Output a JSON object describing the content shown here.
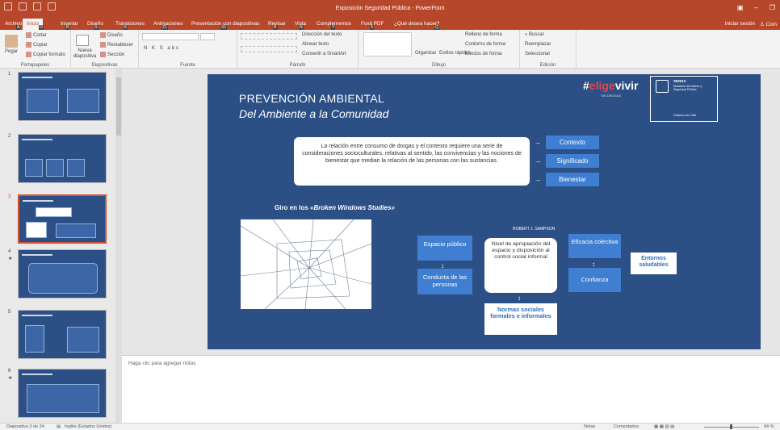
{
  "app": {
    "title": "Exposición Seguridad Pública - PowerPoint",
    "signin": "Iniciar sesión",
    "share": "Com"
  },
  "tabs": [
    "Archivo",
    "Inicio",
    "Insertar",
    "Diseño",
    "Transiciones",
    "Animaciones",
    "Presentación con diapositivas",
    "Revisar",
    "Vista",
    "Complementos",
    "Foxit PDF",
    "¿Qué desea hacer?"
  ],
  "keytips": [
    "A",
    "O",
    "B",
    "G",
    "K",
    "Z1",
    "S1",
    "R",
    "N",
    "Y",
    "X",
    "Q",
    "F1",
    "Y1",
    "8",
    "4"
  ],
  "ribbon": {
    "clipboard": {
      "label": "Portapapeles",
      "paste": "Pegar",
      "cut": "Cortar",
      "copy": "Copiar",
      "format": "Copiar formato"
    },
    "slides": {
      "label": "Diapositivas",
      "new": "Nueva diapositiva",
      "layout": "Diseño",
      "reset": "Restablecer",
      "section": "Sección"
    },
    "font": {
      "label": "Fuente",
      "bold": "N",
      "italic": "K",
      "underline": "S",
      "strike": "abc"
    },
    "paragraph": {
      "label": "Párrafo",
      "direction": "Dirección del texto",
      "align": "Alinear texto",
      "smartart": "Convertir a SmartArt"
    },
    "drawing": {
      "label": "Dibujo",
      "arrange": "Organizar",
      "styles": "Estilos rápidos",
      "fill": "Relleno de forma",
      "outline": "Contorno de forma",
      "effects": "Efectos de forma"
    },
    "editing": {
      "label": "Edición",
      "find": "Buscar",
      "replace": "Reemplazar",
      "select": "Seleccionar"
    }
  },
  "thumbnails": [
    {
      "num": "1",
      "title": "Prevención Ambiental y Universal"
    },
    {
      "num": "2",
      "title": "Intervención ambiental"
    },
    {
      "num": "3",
      "title": "Prevención Ambiental"
    },
    {
      "num": "4",
      "star": "★",
      "title": "¿Por qué evidencian las más comunes?"
    },
    {
      "num": "5",
      "title": "Prevención Ambiental"
    },
    {
      "num": "6",
      "star": "★",
      "title": "Estrategias Ambientales"
    }
  ],
  "slide": {
    "title": "PREVENCIÓN AMBIENTAL",
    "subtitle": "Del Ambiente a la Comunidad",
    "logo_hash": "#",
    "logo_elige": "elige",
    "logo_vivir": "vivir",
    "logo_sub": "SIN DROGAS",
    "senda": "SENDA",
    "senda_sub": "Ministerio del Interior y Seguridad Pública",
    "gobierno": "Gobierno de Chile",
    "relation": "La relación entre consumo de drogas y el contexto requiere una serie de consideraciones socioculturales, relativas al sentido, las convivencias y las nociones de bienestar que median la relación de las personas con las sustancias.",
    "context": "Contexto",
    "meaning": "Significado",
    "wellbeing": "Bienestar",
    "giro_prefix": "Giro en los ",
    "giro_emph": "«Broken Windows Studies»",
    "sampson": "ROBERT J. SAMPSON",
    "espacio": "Espacio público",
    "conducta": "Conducta de las personas",
    "nivel": "Nivel de apropiación del espacio y disposición al control social informal",
    "eficacia": "Eficacia colectiva",
    "confianza": "Confianza",
    "entornos": "Entornos saludables",
    "normas": "Normas sociales formales e informales",
    "link_arrow": "→",
    "updown": "↕"
  },
  "notes_placeholder": "Haga clic para agregar notas",
  "status": {
    "slide": "Diapositiva 3 de 24",
    "lang": "Inglés (Estados Unidos)",
    "notes": "Notas",
    "comments": "Comentarios",
    "zoom": "94 %"
  },
  "colors": {
    "accent": "#b7472a",
    "slide_bg": "#2c4f86",
    "box": "#3f7ed0"
  }
}
